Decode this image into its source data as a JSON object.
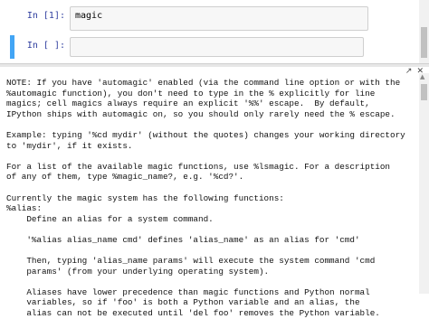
{
  "cells": [
    {
      "prompt": "In [1]:",
      "code": "magic"
    },
    {
      "prompt": "In [ ]:",
      "code": ""
    }
  ],
  "pager": {
    "icons": [
      "expand-icon",
      "close-icon"
    ],
    "lines": [
      "NOTE: If you have 'automagic' enabled (via the command line option or with the",
      "%automagic function), you don't need to type in the % explicitly for line",
      "magics; cell magics always require an explicit '%%' escape.  By default,",
      "IPython ships with automagic on, so you should only rarely need the % escape.",
      "",
      "Example: typing '%cd mydir' (without the quotes) changes your working directory",
      "to 'mydir', if it exists.",
      "",
      "For a list of the available magic functions, use %lsmagic. For a description",
      "of any of them, type %magic_name?, e.g. '%cd?'.",
      "",
      "Currently the magic system has the following functions:",
      "%alias:",
      "    Define an alias for a system command.",
      "",
      "    '%alias alias_name cmd' defines 'alias_name' as an alias for 'cmd'",
      "",
      "    Then, typing 'alias_name params' will execute the system command 'cmd",
      "    params' (from your underlying operating system).",
      "",
      "    Aliases have lower precedence than magic functions and Python normal",
      "    variables, so if 'foo' is both a Python variable and an alias, the",
      "    alias can not be executed until 'del foo' removes the Python variable."
    ]
  }
}
